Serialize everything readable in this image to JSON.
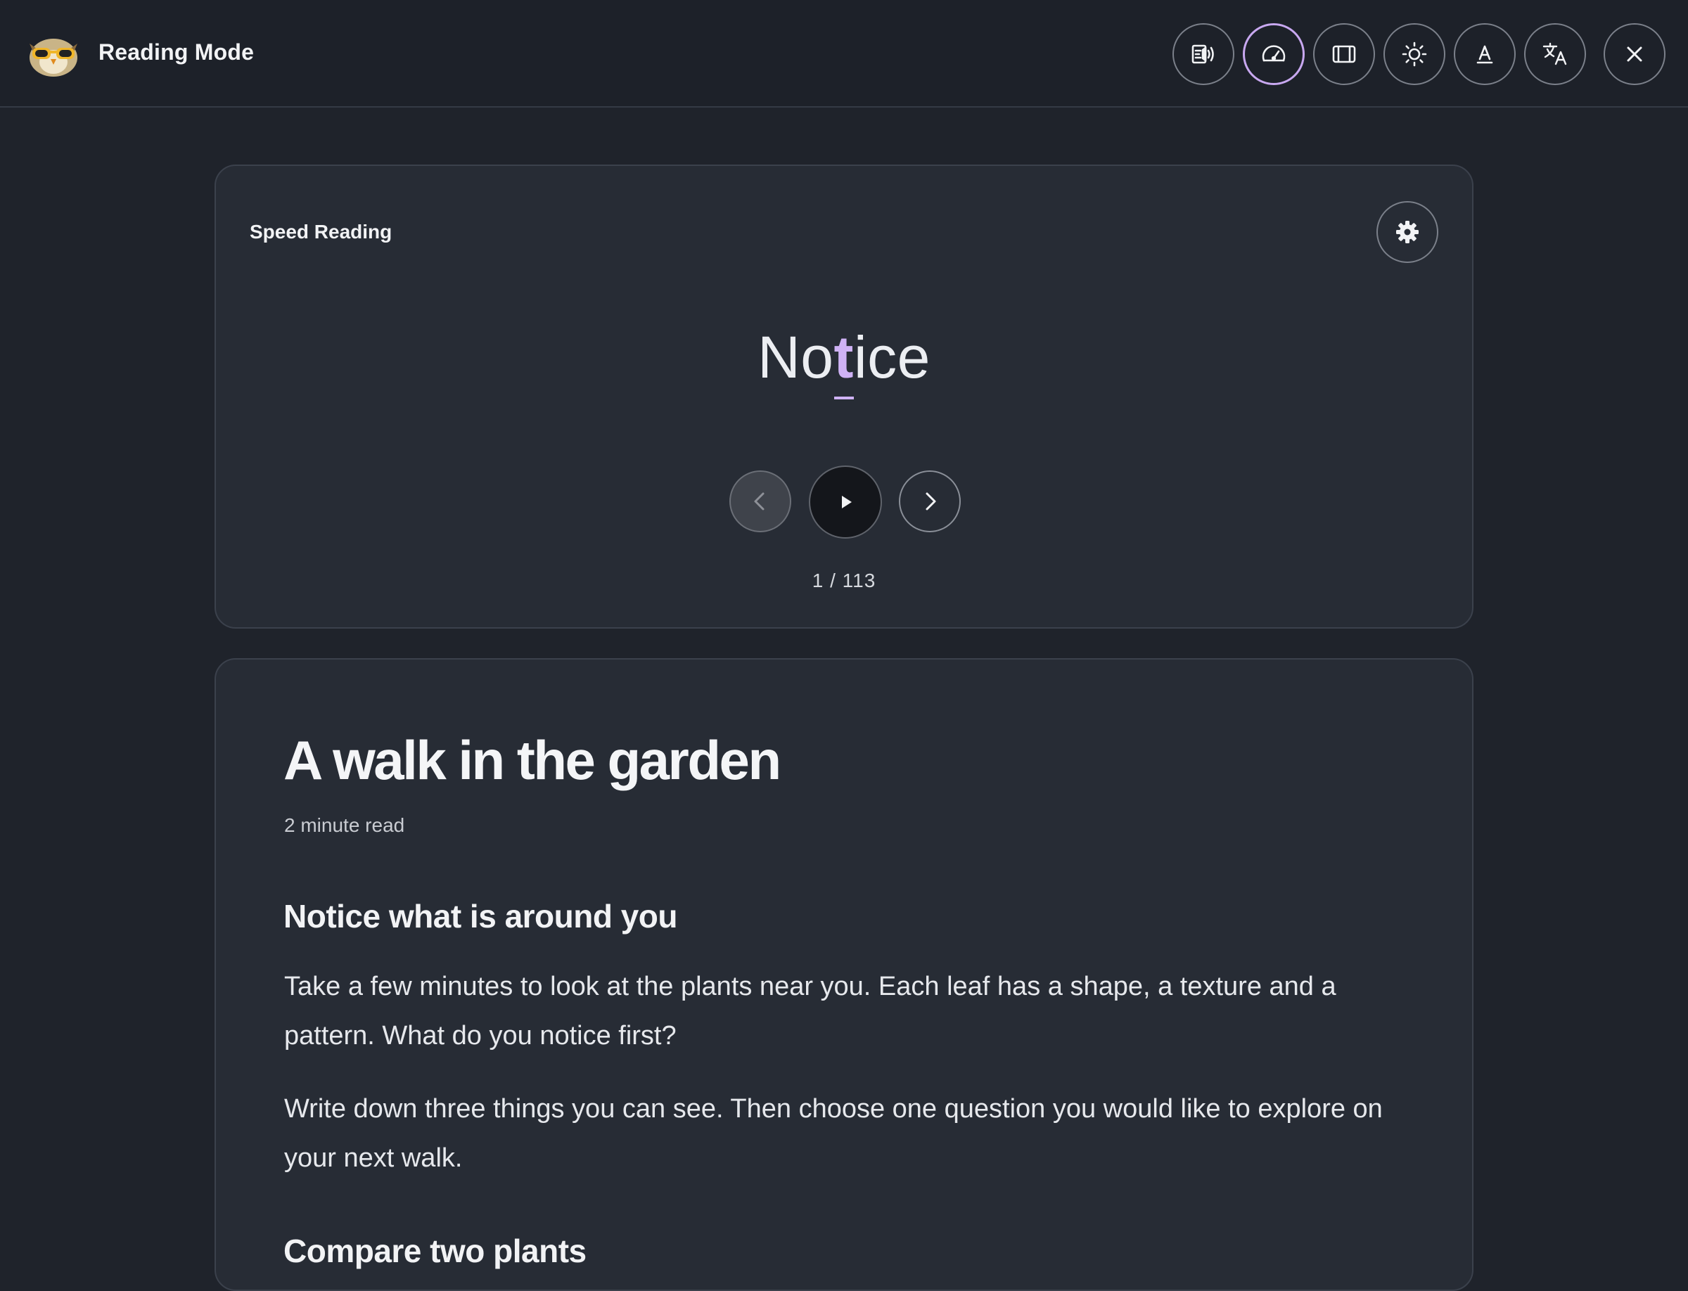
{
  "header": {
    "title": "Reading Mode",
    "logo_icon": "owl-icon",
    "toolbar": [
      {
        "name": "read-aloud-button",
        "icon": "read-aloud-icon",
        "active": false
      },
      {
        "name": "speed-reading-button",
        "icon": "speedometer-icon",
        "active": true
      },
      {
        "name": "layout-button",
        "icon": "columns-icon",
        "active": false
      },
      {
        "name": "theme-button",
        "icon": "sun-icon",
        "active": false
      },
      {
        "name": "font-button",
        "icon": "text-style-icon",
        "active": false
      },
      {
        "name": "translate-button",
        "icon": "translate-icon",
        "active": false
      }
    ],
    "close_icon": "close-icon"
  },
  "speed_reading": {
    "label": "Speed Reading",
    "settings_icon": "gear-icon",
    "word_pre": "No",
    "word_focus": "t",
    "word_post": "ice",
    "prev_icon": "chevron-left-icon",
    "play_icon": "play-icon",
    "next_icon": "chevron-right-icon",
    "progress": "1 / 113",
    "current_index": 1,
    "total_words": 113
  },
  "article": {
    "title": "A walk in the garden",
    "read_time": "2 minute read",
    "sections": [
      {
        "heading": "Notice what is around you",
        "paragraphs": [
          "Take a few minutes to look at the plants near you. Each leaf has a shape, a texture and a pattern. What do you notice first?",
          "Write down three things you can see. Then choose one question you would like to explore on your next walk."
        ]
      },
      {
        "heading": "Compare two plants"
      }
    ]
  },
  "colors": {
    "background": "#1f232b",
    "card": "#272c35",
    "accent": "#cfb2f5"
  }
}
